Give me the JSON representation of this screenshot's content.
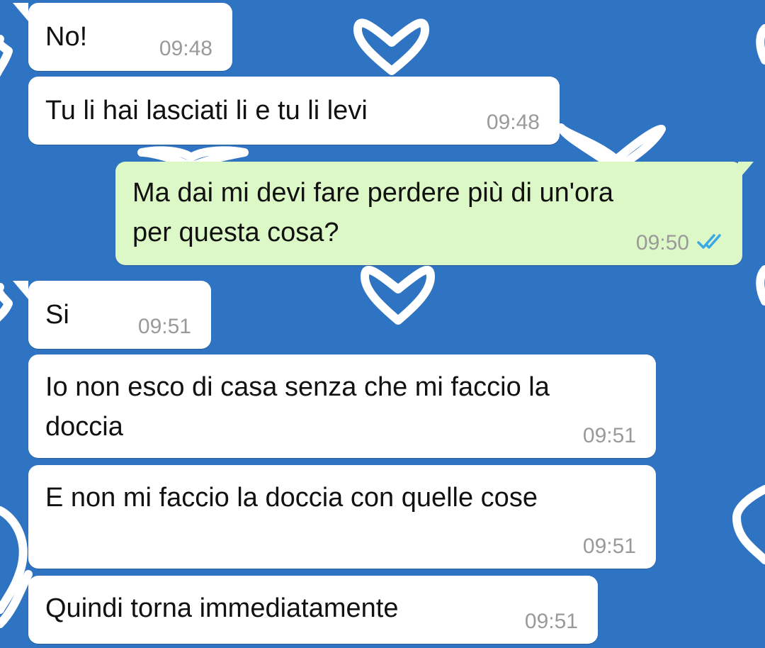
{
  "messages": [
    {
      "direction": "incoming",
      "text": "No!",
      "time": "09:48"
    },
    {
      "direction": "incoming",
      "text": "Tu li hai lasciati li e tu li levi",
      "time": "09:48"
    },
    {
      "direction": "outgoing",
      "text": "Ma dai mi devi fare perdere più di un'ora\nper questa cosa?",
      "time": "09:50",
      "status": "read",
      "status_icon": "double-check-icon"
    },
    {
      "direction": "incoming",
      "text": "Si",
      "time": "09:51"
    },
    {
      "direction": "incoming",
      "text": "Io non esco di casa senza che mi faccio la\ndoccia",
      "time": "09:51"
    },
    {
      "direction": "incoming",
      "text": "E non mi faccio la doccia con quelle cose",
      "time": "09:51"
    },
    {
      "direction": "incoming",
      "text": "Quindi torna immediatamente",
      "time": "09:51"
    }
  ],
  "colors": {
    "wallpaper": "#2f74c2",
    "incoming_bubble": "#ffffff",
    "outgoing_bubble": "#dcf8c6",
    "timestamp": "#9a9a9a",
    "read_ticks": "#3ca9e6"
  },
  "wallpaper_pattern": "heart-icon"
}
